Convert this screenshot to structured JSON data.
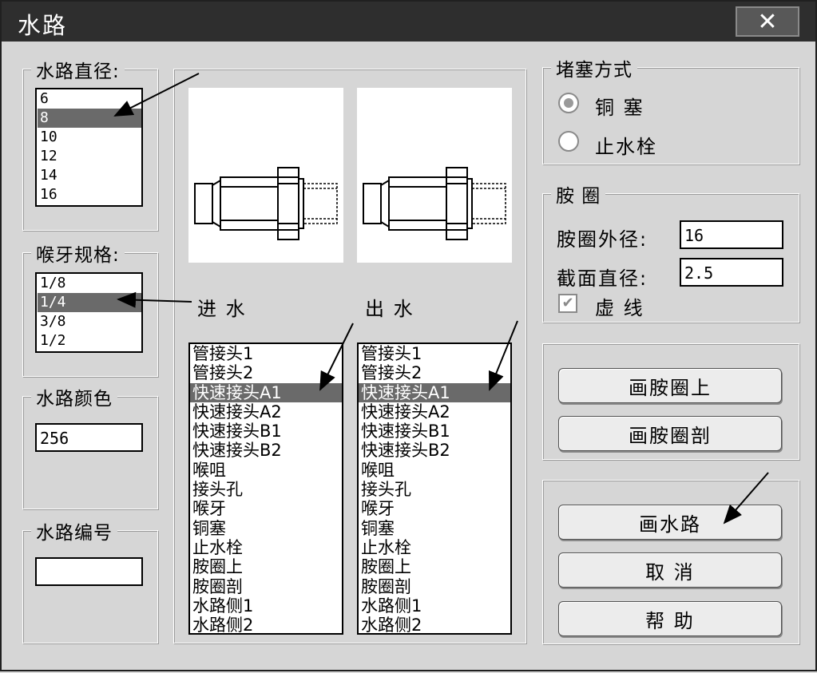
{
  "window": {
    "title": "水路",
    "close_icon": "close-icon"
  },
  "diameter": {
    "label": "水路直径:",
    "items": [
      "6",
      "8",
      "10",
      "12",
      "14",
      "16"
    ],
    "selected": "8"
  },
  "thread": {
    "label": "喉牙规格:",
    "items": [
      "1/8",
      "1/4",
      "3/8",
      "1/2"
    ],
    "selected": "1/4"
  },
  "color": {
    "label": "水路颜色",
    "value": "256"
  },
  "number": {
    "label": "水路编号",
    "value": ""
  },
  "inlet": {
    "label": "进 水",
    "items": [
      "管接头1",
      "管接头2",
      "快速接头A1",
      "快速接头A2",
      "快速接头B1",
      "快速接头B2",
      "喉咀",
      "接头孔",
      "喉牙",
      "铜塞",
      "止水栓",
      "胺圈上",
      "胺圈剖",
      "水路侧1",
      "水路侧2"
    ],
    "selected": "快速接头A1"
  },
  "outlet": {
    "label": "出 水",
    "items": [
      "管接头1",
      "管接头2",
      "快速接头A1",
      "快速接头A2",
      "快速接头B1",
      "快速接头B2",
      "喉咀",
      "接头孔",
      "喉牙",
      "铜塞",
      "止水栓",
      "胺圈上",
      "胺圈剖",
      "水路侧1",
      "水路侧2"
    ],
    "selected": "快速接头A1"
  },
  "plug": {
    "label": "堵塞方式",
    "option1": "铜 塞",
    "option2": "止水栓",
    "selected": "铜 塞"
  },
  "oring": {
    "label": "胺 圈",
    "outer_label": "胺圈外径:",
    "outer_value": "16",
    "section_label": "截面直径:",
    "section_value": "2.5",
    "dashed_label": "虚 线",
    "dashed_checked": true
  },
  "buttons": {
    "draw_oring_top": "画胺圈上",
    "draw_oring_section": "画胺圈剖",
    "draw_waterway": "画水路",
    "cancel": "取 消",
    "help": "帮 助"
  }
}
